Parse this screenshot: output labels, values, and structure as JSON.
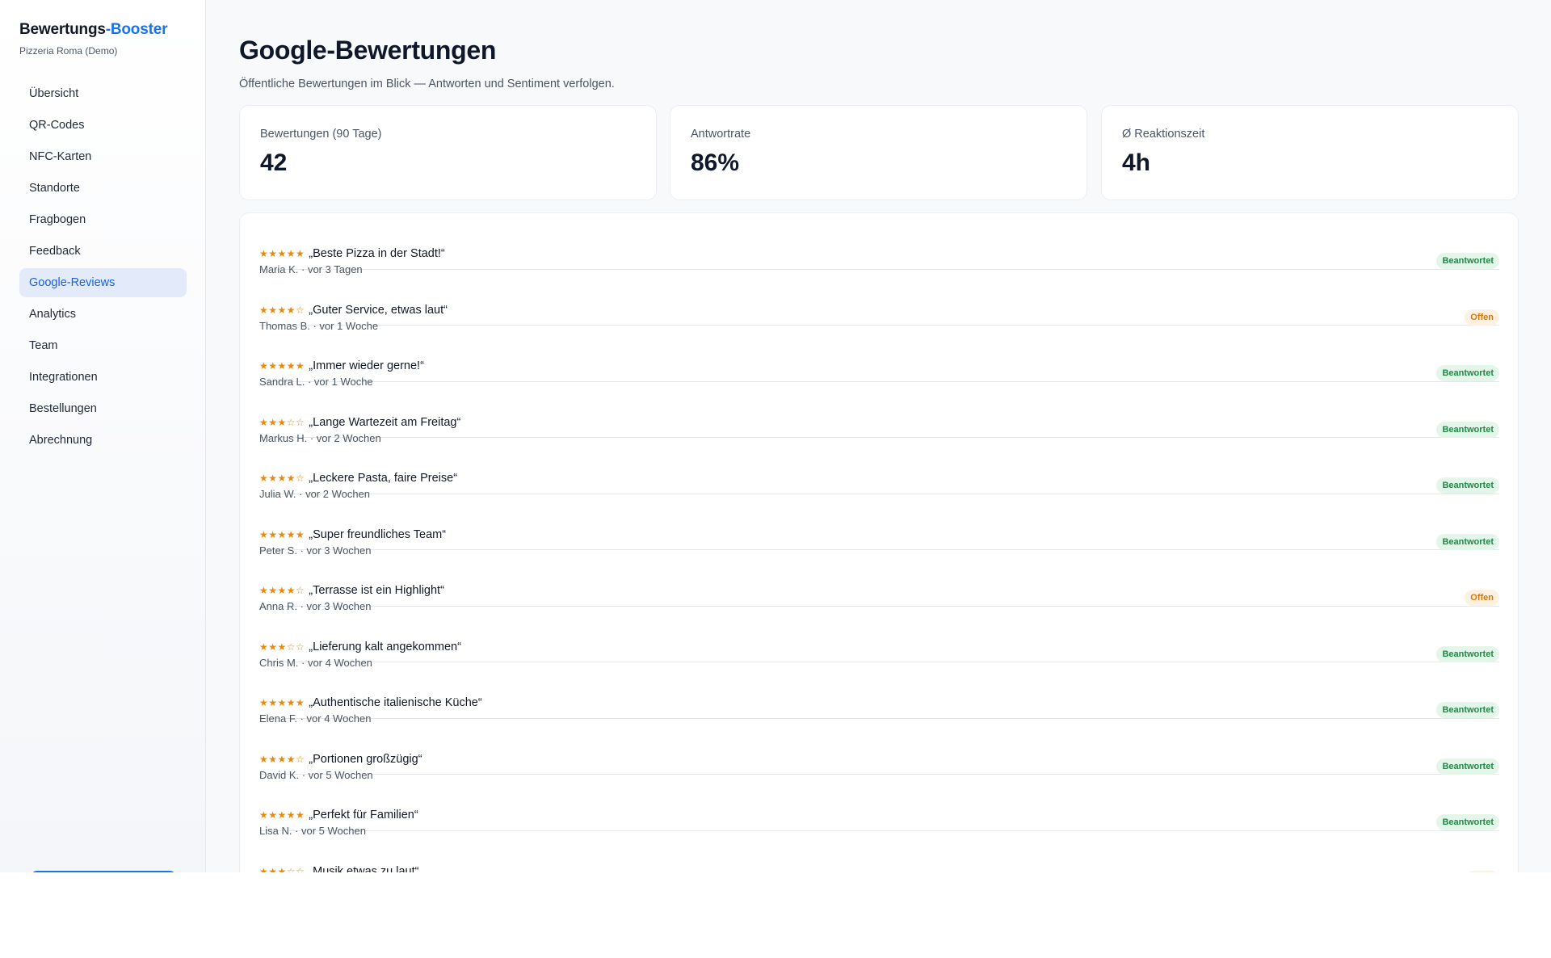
{
  "brand": {
    "name": "Bewertungs",
    "accent": "-Booster",
    "subtitle": "Pizzeria Roma (Demo)"
  },
  "sidebar": {
    "items": [
      {
        "label": "Übersicht"
      },
      {
        "label": "QR-Codes"
      },
      {
        "label": "NFC-Karten"
      },
      {
        "label": "Standorte"
      },
      {
        "label": "Fragbogen"
      },
      {
        "label": "Feedback"
      },
      {
        "label": "Google-Reviews",
        "active": true
      },
      {
        "label": "Analytics"
      },
      {
        "label": "Team"
      },
      {
        "label": "Integrationen"
      },
      {
        "label": "Bestellungen"
      },
      {
        "label": "Abrechnung"
      }
    ]
  },
  "page": {
    "title": "Google-Bewertungen",
    "subtitle": "Öffentliche Bewertungen im Blick — Antworten und Sentiment verfolgen."
  },
  "stats": [
    {
      "label": "Bewertungen (90 Tage)",
      "value": "42"
    },
    {
      "label": "Antwortrate",
      "value": "86%"
    },
    {
      "label": "Ø Reaktionszeit",
      "value": "4h"
    }
  ],
  "reviews": [
    {
      "stars": "★★★★★",
      "rating": 5,
      "title": "„Beste Pizza in der Stadt!“",
      "meta": "Maria K. · vor 3 Tagen",
      "status": "Beantwortet",
      "status_type": "done"
    },
    {
      "stars": "★★★★☆",
      "rating": 4,
      "title": "„Guter Service, etwas laut“",
      "meta": "Thomas B. · vor 1 Woche",
      "status": "Offen",
      "status_type": "open"
    },
    {
      "stars": "★★★★★",
      "rating": 5,
      "title": "„Immer wieder gerne!“",
      "meta": "Sandra L. · vor 1 Woche",
      "status": "Beantwortet",
      "status_type": "done"
    },
    {
      "stars": "★★★☆☆",
      "rating": 3,
      "title": "„Lange Wartezeit am Freitag“",
      "meta": "Markus H. · vor 2 Wochen",
      "status": "Beantwortet",
      "status_type": "done"
    },
    {
      "stars": "★★★★☆",
      "rating": 4,
      "title": "„Leckere Pasta, faire Preise“",
      "meta": "Julia W. · vor 2 Wochen",
      "status": "Beantwortet",
      "status_type": "done"
    },
    {
      "stars": "★★★★★",
      "rating": 5,
      "title": "„Super freundliches Team“",
      "meta": "Peter S. · vor 3 Wochen",
      "status": "Beantwortet",
      "status_type": "done"
    },
    {
      "stars": "★★★★☆",
      "rating": 4,
      "title": "„Terrasse ist ein Highlight“",
      "meta": "Anna R. · vor 3 Wochen",
      "status": "Offen",
      "status_type": "open"
    },
    {
      "stars": "★★★☆☆",
      "rating": 3,
      "title": "„Lieferung kalt angekommen“",
      "meta": "Chris M. · vor 4 Wochen",
      "status": "Beantwortet",
      "status_type": "done"
    },
    {
      "stars": "★★★★★",
      "rating": 5,
      "title": "„Authentische italienische Küche“",
      "meta": "Elena F. · vor 4 Wochen",
      "status": "Beantwortet",
      "status_type": "done"
    },
    {
      "stars": "★★★★☆",
      "rating": 4,
      "title": "„Portionen großzügig“",
      "meta": "David K. · vor 5 Wochen",
      "status": "Beantwortet",
      "status_type": "done"
    },
    {
      "stars": "★★★★★",
      "rating": 5,
      "title": "„Perfekt für Familien“",
      "meta": "Lisa N. · vor 5 Wochen",
      "status": "Beantwortet",
      "status_type": "done"
    },
    {
      "stars": "★★★☆☆",
      "rating": 3,
      "title": "„Musik etwas zu laut“",
      "meta": "",
      "status": "",
      "status_type": "open"
    }
  ],
  "colors": {
    "accent": "#1a73e8",
    "star": "#e8890c",
    "answered": "#1f8a45",
    "open": "#d97706"
  }
}
